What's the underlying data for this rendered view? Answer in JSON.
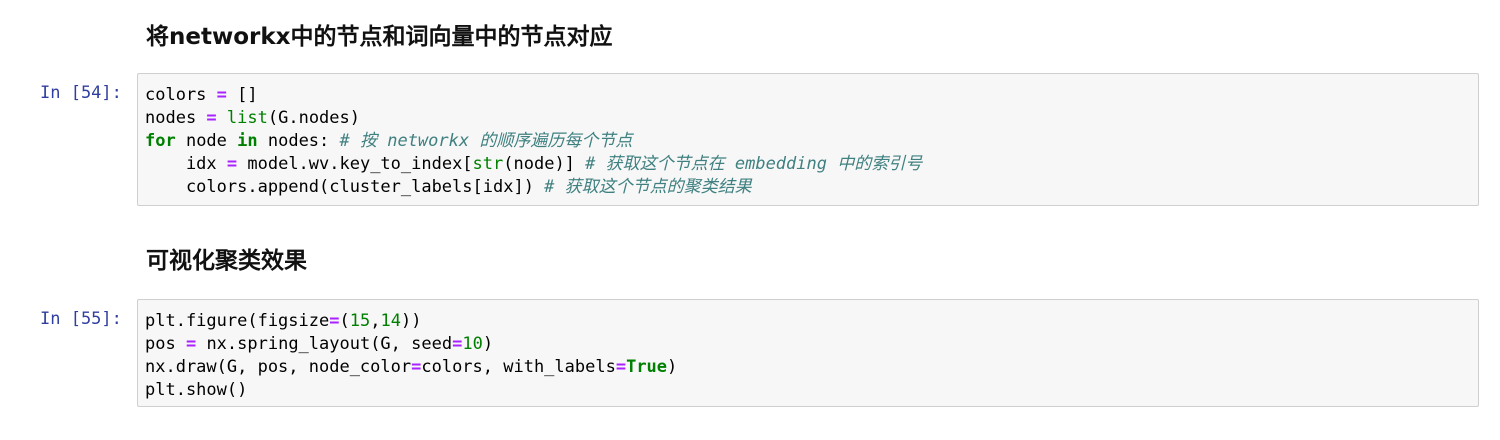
{
  "markdown": {
    "heading_1": "将networkx中的节点和词向量中的节点对应",
    "heading_2": "可视化聚类效果"
  },
  "cells": [
    {
      "prompt": "In [54]:",
      "lines": [
        [
          {
            "t": "colors ",
            "c": "plain"
          },
          {
            "t": "=",
            "c": "op"
          },
          {
            "t": " []",
            "c": "plain"
          }
        ],
        [
          {
            "t": "nodes ",
            "c": "plain"
          },
          {
            "t": "=",
            "c": "op"
          },
          {
            "t": " ",
            "c": "plain"
          },
          {
            "t": "list",
            "c": "bi"
          },
          {
            "t": "(G.nodes)",
            "c": "plain"
          }
        ],
        [
          {
            "t": "for",
            "c": "kw"
          },
          {
            "t": " node ",
            "c": "plain"
          },
          {
            "t": "in",
            "c": "kw"
          },
          {
            "t": " nodes: ",
            "c": "plain"
          },
          {
            "t": "# 按 networkx 的顺序遍历每个节点",
            "c": "cm"
          }
        ],
        [
          {
            "t": "    idx ",
            "c": "plain"
          },
          {
            "t": "=",
            "c": "op"
          },
          {
            "t": " model.wv.key_to_index[",
            "c": "plain"
          },
          {
            "t": "str",
            "c": "bi"
          },
          {
            "t": "(node)] ",
            "c": "plain"
          },
          {
            "t": "# 获取这个节点在 embedding 中的索引号",
            "c": "cm"
          }
        ],
        [
          {
            "t": "    colors.append(cluster_labels[idx]) ",
            "c": "plain"
          },
          {
            "t": "# 获取这个节点的聚类结果",
            "c": "cm"
          }
        ]
      ]
    },
    {
      "prompt": "In [55]:",
      "lines": [
        [
          {
            "t": "plt.figure(figsize",
            "c": "plain"
          },
          {
            "t": "=",
            "c": "op"
          },
          {
            "t": "(",
            "c": "plain"
          },
          {
            "t": "15",
            "c": "num"
          },
          {
            "t": ",",
            "c": "plain"
          },
          {
            "t": "14",
            "c": "num"
          },
          {
            "t": "))",
            "c": "plain"
          }
        ],
        [
          {
            "t": "pos ",
            "c": "plain"
          },
          {
            "t": "=",
            "c": "op"
          },
          {
            "t": " nx.spring_layout(G, seed",
            "c": "plain"
          },
          {
            "t": "=",
            "c": "op"
          },
          {
            "t": "10",
            "c": "num"
          },
          {
            "t": ")",
            "c": "plain"
          }
        ],
        [
          {
            "t": "nx.draw(G, pos, node_color",
            "c": "plain"
          },
          {
            "t": "=",
            "c": "op"
          },
          {
            "t": "colors, with_labels",
            "c": "plain"
          },
          {
            "t": "=",
            "c": "op"
          },
          {
            "t": "True",
            "c": "kw"
          },
          {
            "t": ")",
            "c": "plain"
          }
        ],
        [
          {
            "t": "plt.show()",
            "c": "plain"
          }
        ]
      ]
    }
  ],
  "colors": {
    "prompt": "#303f9f",
    "operator": "#aa22ff",
    "keyword": "#008000",
    "comment": "#408080",
    "cell_background": "#f7f7f7",
    "cell_border": "#cfcfcf"
  }
}
